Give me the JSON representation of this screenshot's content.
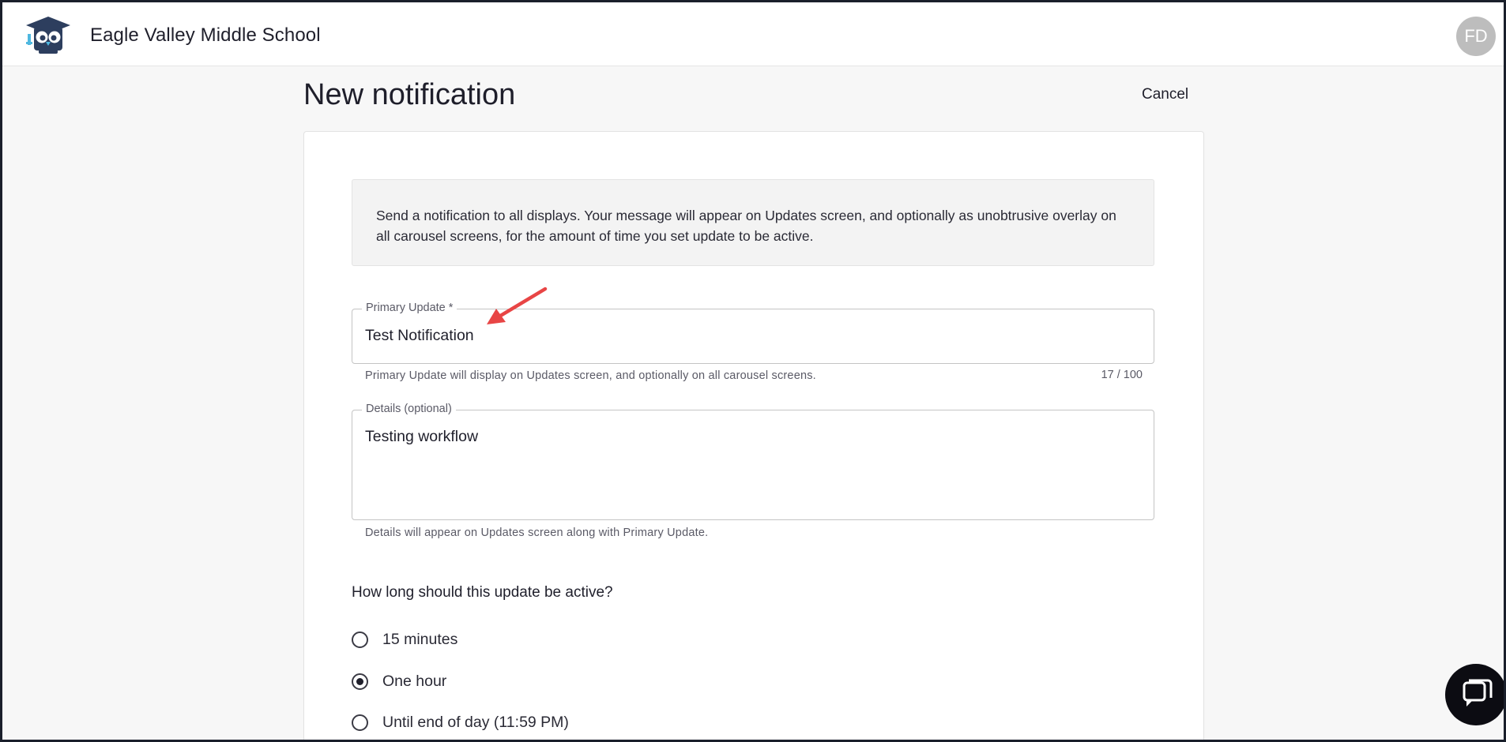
{
  "header": {
    "school_name": "Eagle Valley Middle School",
    "avatar_initials": "FD"
  },
  "page": {
    "title": "New notification",
    "cancel_label": "Cancel"
  },
  "form": {
    "info_text": "Send a notification to all displays. Your message will appear on Updates screen, and optionally as unobtrusive overlay on all carousel screens, for the amount of time you set update to be active.",
    "primary_update": {
      "label": "Primary Update *",
      "value": "Test Notification",
      "helper": "Primary Update will display on Updates screen, and optionally on all carousel screens.",
      "counter": "17 / 100"
    },
    "details": {
      "label": "Details (optional)",
      "value": "Testing workflow",
      "helper": "Details will appear on Updates screen along with Primary Update."
    },
    "duration": {
      "question": "How long should this update be active?",
      "options": [
        {
          "label": "15 minutes",
          "selected": false
        },
        {
          "label": "One hour",
          "selected": true
        },
        {
          "label": "Until end of day (11:59 PM)",
          "selected": false
        }
      ]
    }
  },
  "colors": {
    "annotation_arrow": "#e84545",
    "logo_navy": "#2d3e5e",
    "logo_accent": "#4fb8e0"
  }
}
